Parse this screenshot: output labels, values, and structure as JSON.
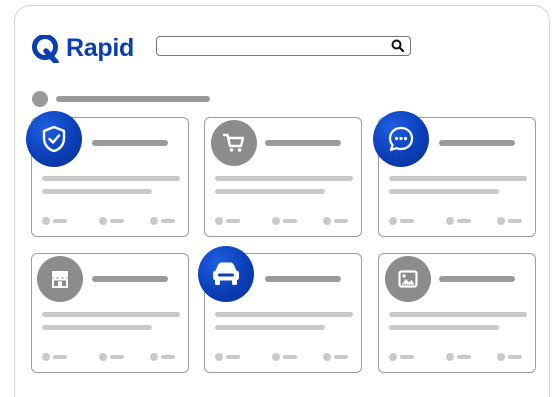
{
  "brand": {
    "name": "Rapid",
    "color": "#0a3fb2"
  },
  "search": {
    "placeholder": "",
    "icon": "search-icon"
  },
  "cards": [
    {
      "icon": "shield-check-icon",
      "highlighted": true
    },
    {
      "icon": "shopping-cart-icon",
      "highlighted": false
    },
    {
      "icon": "chat-bubble-icon",
      "highlighted": true
    },
    {
      "icon": "storefront-icon",
      "highlighted": false
    },
    {
      "icon": "car-icon",
      "highlighted": true
    },
    {
      "icon": "image-icon",
      "highlighted": false
    }
  ],
  "colors": {
    "accent": "#0b3fb8",
    "placeholder_gray": "#9a9a9a",
    "icon_gray": "#8c8c8c"
  }
}
